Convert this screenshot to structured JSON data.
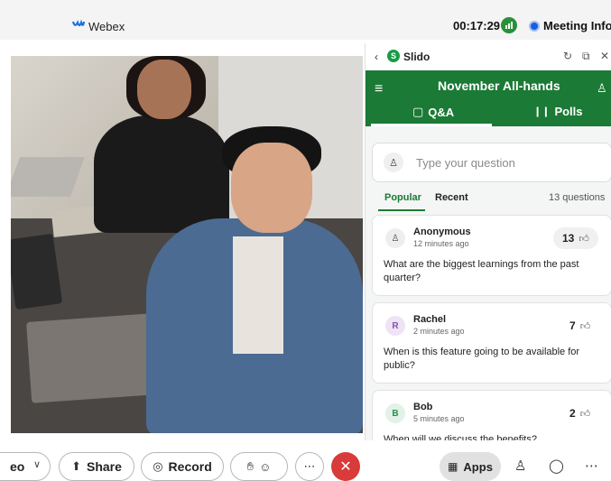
{
  "titlebar": {
    "app_name": "Webex",
    "timer": "00:17:29",
    "meeting_info": "Meeting Info"
  },
  "controls": {
    "video_label": "eo",
    "share_label": "Share",
    "record_label": "Record",
    "apps_label": "Apps"
  },
  "slido": {
    "title": "Slido",
    "event_title": "November All-hands",
    "tabs": [
      {
        "label": "Q&A",
        "active": true
      },
      {
        "label": "Polls",
        "active": false
      }
    ],
    "ask_placeholder": "Type your question",
    "filters": [
      {
        "label": "Popular",
        "active": true
      },
      {
        "label": "Recent",
        "active": false
      }
    ],
    "question_count": "13 questions",
    "questions": [
      {
        "avatar": "",
        "author": "Anonymous",
        "time": "12 minutes ago",
        "votes": "13",
        "text": "What are the biggest learnings from the past quarter?"
      },
      {
        "avatar": "R",
        "author": "Rachel",
        "time": "2 minutes ago",
        "votes": "7",
        "text": "When is this feature going to be available for public?"
      },
      {
        "avatar": "B",
        "author": "Bob",
        "time": "5 minutes ago",
        "votes": "2",
        "text": "When will we discuss the benefits?"
      }
    ]
  },
  "colors": {
    "slido_green": "#1b7a35",
    "end_call_red": "#d93a3a",
    "meeting_info_blue": "#1a5fd6"
  }
}
